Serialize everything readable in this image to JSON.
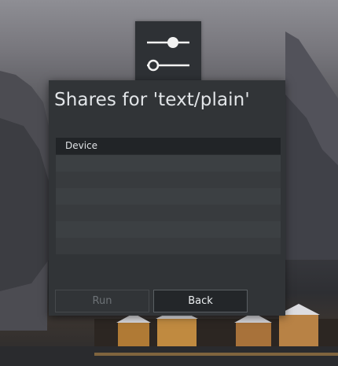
{
  "dialog": {
    "title": "Shares for 'text/plain'",
    "list": {
      "column_header": "Device"
    },
    "buttons": {
      "run": "Run",
      "back": "Back"
    }
  },
  "app_icon": {
    "name": "settings-sliders-icon"
  },
  "colors": {
    "dialog_bg": "#313437",
    "header_bg": "#212427",
    "text": "#e2e5e8",
    "disabled_text": "#6d7276"
  }
}
